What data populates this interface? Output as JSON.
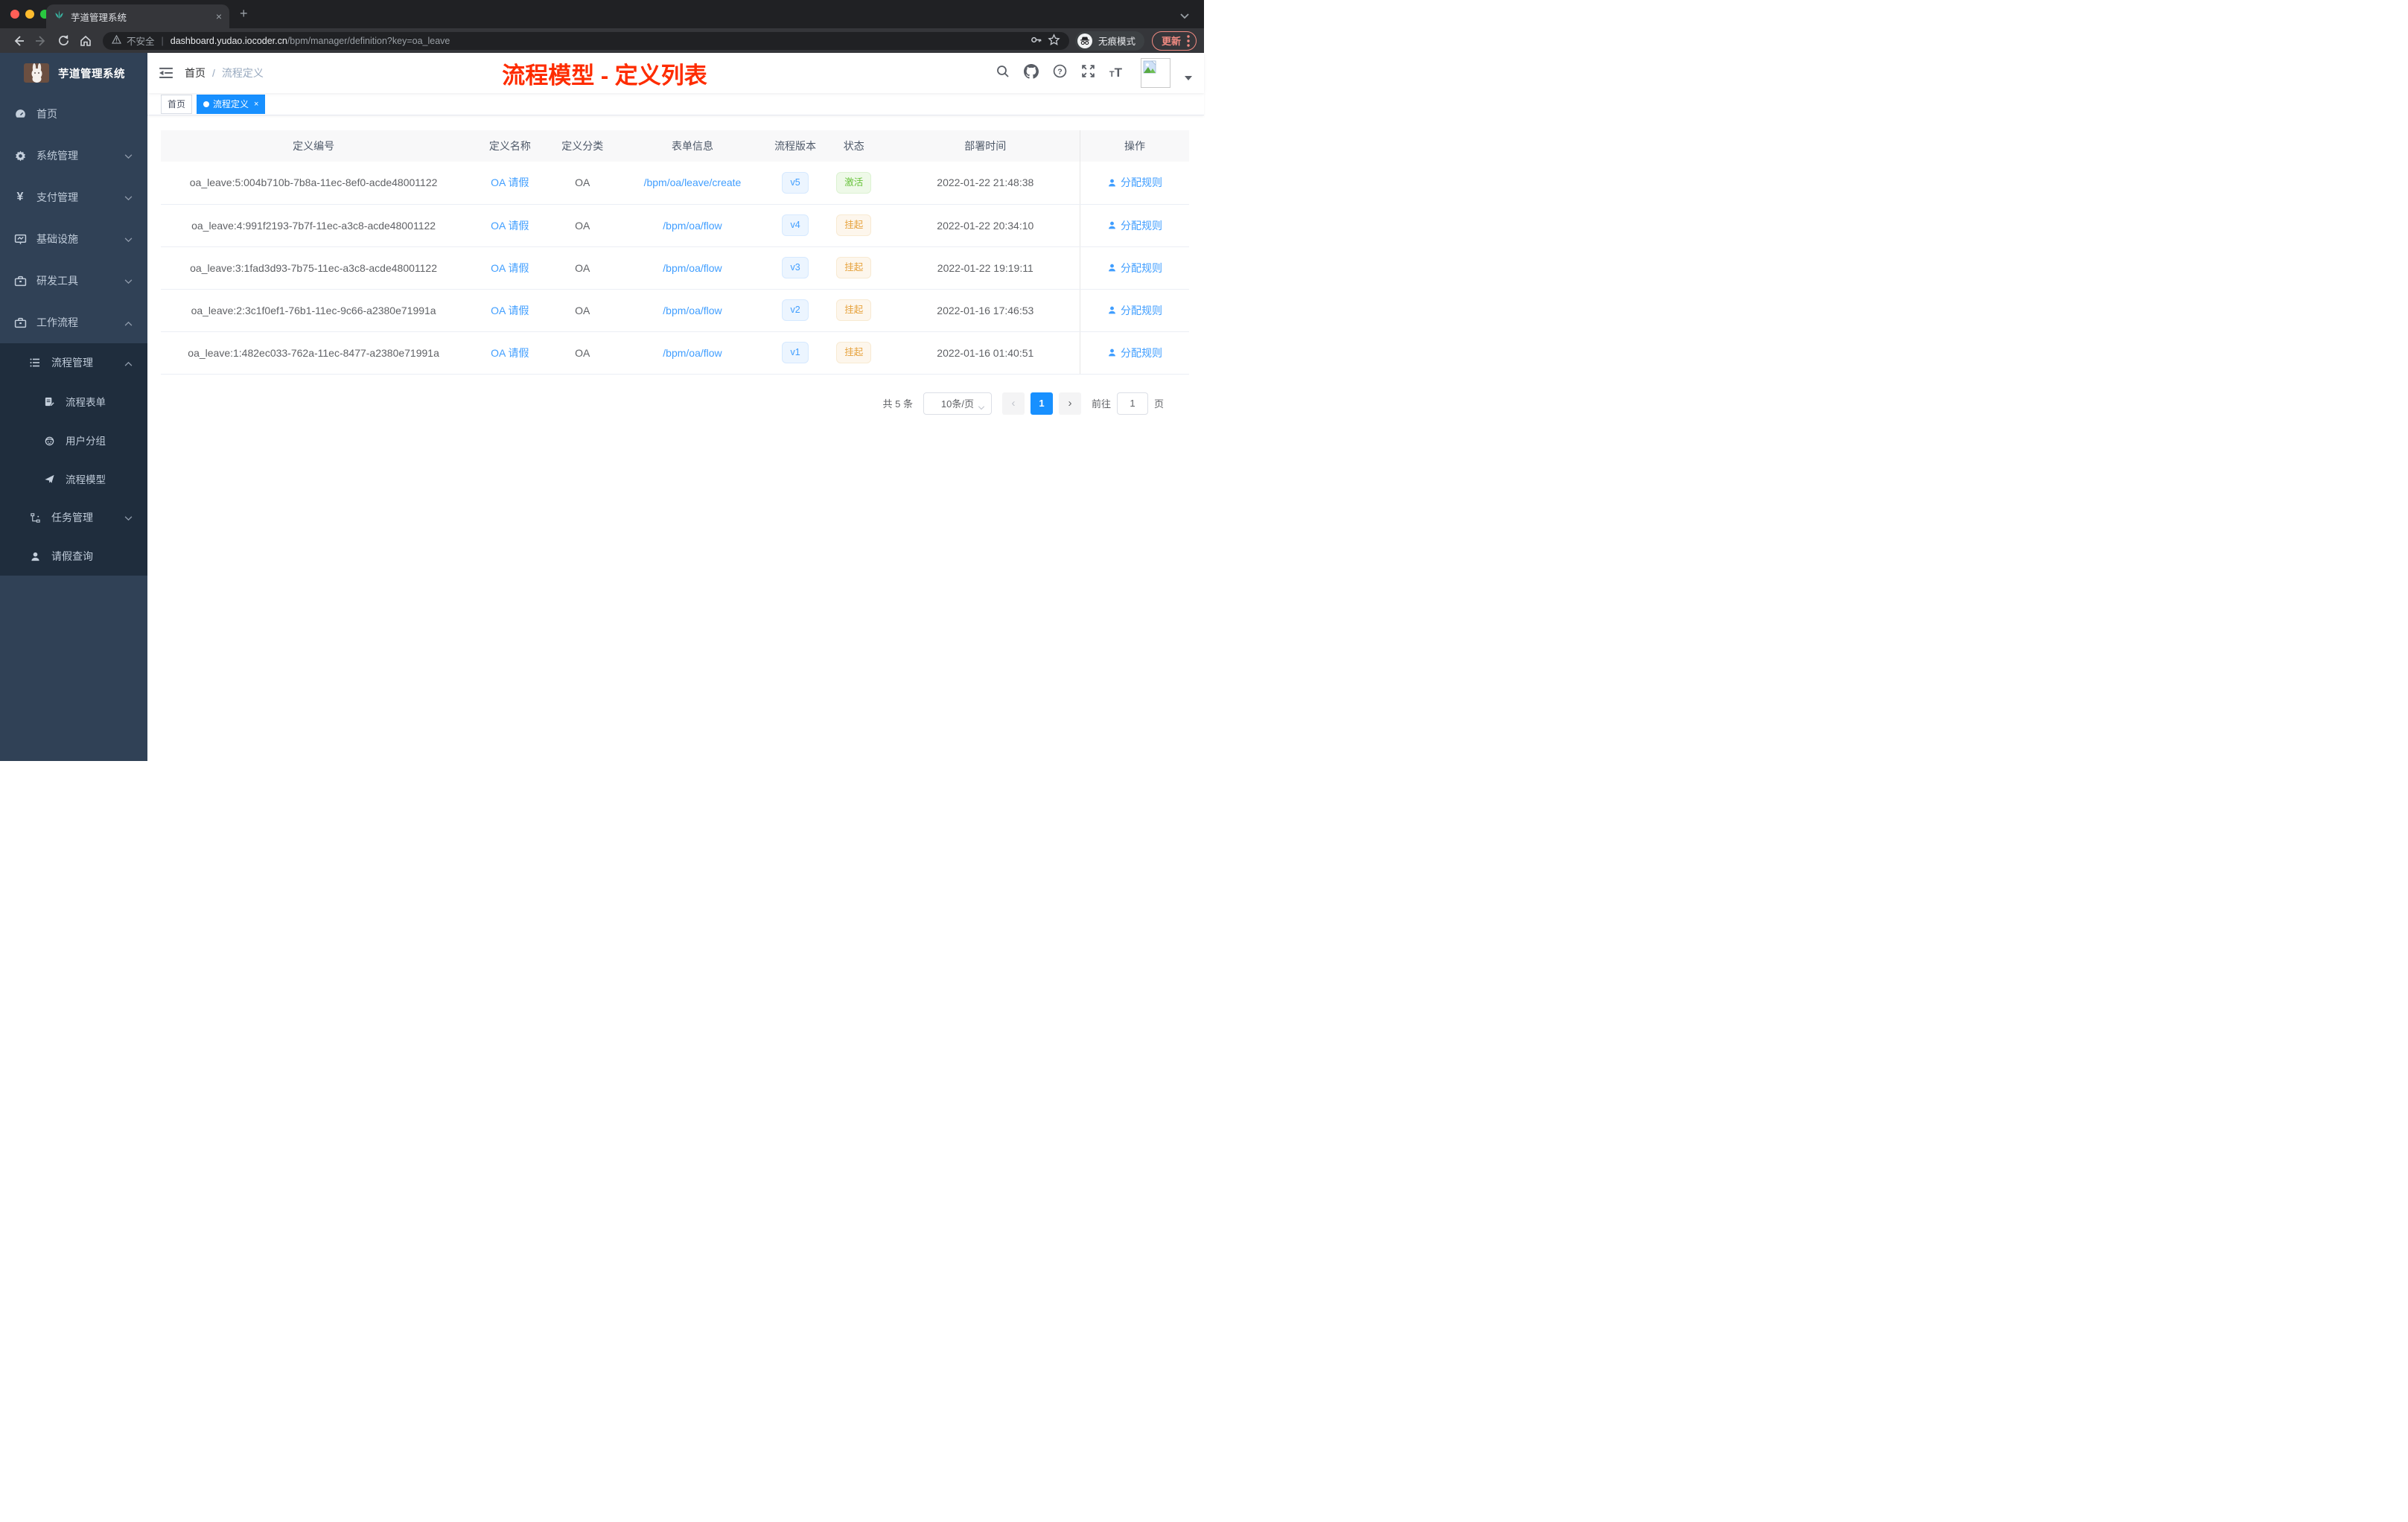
{
  "browser": {
    "tab_title": "芋道管理系统",
    "new_tab_button": "+",
    "security_label": "不安全",
    "url_host": "dashboard.yudao.iocoder.cn",
    "url_path": "/bpm/manager/definition?key=oa_leave",
    "incognito_label": "无痕模式",
    "update_label": "更新"
  },
  "annotation": {
    "text": "流程模型 - 定义列表",
    "color": "#fe2c00"
  },
  "sidebar": {
    "logo_title": "芋道管理系统",
    "items": [
      {
        "label": "首页",
        "icon": "dashboard-icon"
      },
      {
        "label": "系统管理",
        "icon": "gear-icon"
      },
      {
        "label": "支付管理",
        "icon": "yen-icon"
      },
      {
        "label": "基础设施",
        "icon": "monitor-icon"
      },
      {
        "label": "研发工具",
        "icon": "toolbox-icon"
      },
      {
        "label": "工作流程",
        "icon": "briefcase-icon"
      },
      {
        "label": "流程管理",
        "icon": "flow-list-icon"
      },
      {
        "label": "流程表单",
        "icon": "form-icon"
      },
      {
        "label": "用户分组",
        "icon": "robot-icon"
      },
      {
        "label": "流程模型",
        "icon": "paper-plane-icon"
      },
      {
        "label": "任务管理",
        "icon": "task-tree-icon"
      },
      {
        "label": "请假查询",
        "icon": "user-icon"
      }
    ]
  },
  "navbar": {
    "breadcrumb_home": "首页",
    "breadcrumb_sep": "/",
    "breadcrumb_current": "流程定义"
  },
  "tags": {
    "home": "首页",
    "active": "流程定义"
  },
  "table": {
    "columns": {
      "id": "定义编号",
      "name": "定义名称",
      "category": "定义分类",
      "form": "表单信息",
      "version": "流程版本",
      "status": "状态",
      "deploy_time": "部署时间",
      "action": "操作"
    },
    "rows": [
      {
        "id": "oa_leave:5:004b710b-7b8a-11ec-8ef0-acde48001122",
        "name": "OA 请假",
        "category": "OA",
        "form": "/bpm/oa/leave/create",
        "version": "v5",
        "status": "激活",
        "time": "2022-01-22 21:48:38",
        "action": "分配规则"
      },
      {
        "id": "oa_leave:4:991f2193-7b7f-11ec-a3c8-acde48001122",
        "name": "OA 请假",
        "category": "OA",
        "form": "/bpm/oa/flow",
        "version": "v4",
        "status": "挂起",
        "time": "2022-01-22 20:34:10",
        "action": "分配规则"
      },
      {
        "id": "oa_leave:3:1fad3d93-7b75-11ec-a3c8-acde48001122",
        "name": "OA 请假",
        "category": "OA",
        "form": "/bpm/oa/flow",
        "version": "v3",
        "status": "挂起",
        "time": "2022-01-22 19:19:11",
        "action": "分配规则"
      },
      {
        "id": "oa_leave:2:3c1f0ef1-76b1-11ec-9c66-a2380e71991a",
        "name": "OA 请假",
        "category": "OA",
        "form": "/bpm/oa/flow",
        "version": "v2",
        "status": "挂起",
        "time": "2022-01-16 17:46:53",
        "action": "分配规则"
      },
      {
        "id": "oa_leave:1:482ec033-762a-11ec-8477-a2380e71991a",
        "name": "OA 请假",
        "category": "OA",
        "form": "/bpm/oa/flow",
        "version": "v1",
        "status": "挂起",
        "time": "2022-01-16 01:40:51",
        "action": "分配规则"
      }
    ]
  },
  "pagination": {
    "total": "共 5 条",
    "page_size": "10条/页",
    "prev": "‹",
    "page": "1",
    "next": "›",
    "goto_label": "前往",
    "goto_value": "1",
    "unit_label": "页"
  },
  "colors": {
    "accent_blue": "#409eff",
    "tag_active_blue": "#1890ff",
    "status_active_green": "#67c23a",
    "status_suspend_orange": "#e6a23c",
    "annotation_red": "#fe2c00",
    "sidebar_bg": "#304156",
    "submenu_bg": "#1f2d3d"
  }
}
